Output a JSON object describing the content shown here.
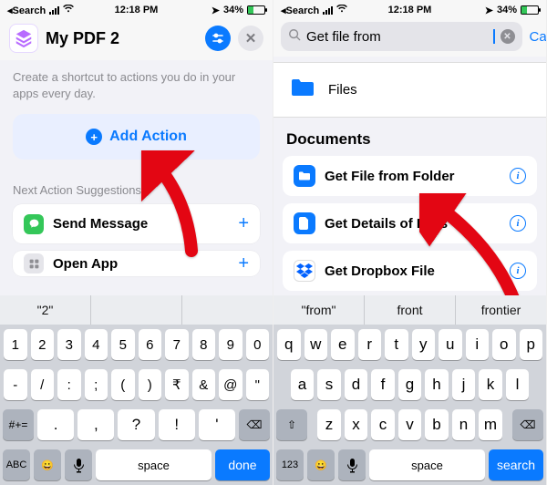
{
  "status": {
    "back": "Search",
    "time": "12:18 PM",
    "battery_pct": "34%"
  },
  "left": {
    "title": "My PDF 2",
    "desc": "Create a shortcut to actions you do in your apps every day.",
    "add_action": "Add Action",
    "suggestions_label": "Next Action Suggestions",
    "suggestions": [
      {
        "label": "Send Message"
      },
      {
        "label": "Open App"
      }
    ],
    "kbd_suggestions": [
      "\"2\"",
      "",
      ""
    ],
    "num_row": [
      "1",
      "2",
      "3",
      "4",
      "5",
      "6",
      "7",
      "8",
      "9",
      "0"
    ],
    "sym_row": [
      "-",
      "/",
      ":",
      ";",
      "(",
      ")",
      "₹",
      "&",
      "@",
      "\""
    ],
    "fn_row_left": "#+=",
    "fn_row_syms": [
      ".",
      ",",
      "?",
      "!",
      "'"
    ],
    "bottom": {
      "abc": "ABC",
      "space": "space",
      "done": "done"
    }
  },
  "right": {
    "search_value": "Get file from",
    "cancel": "Cancel",
    "files_label": "Files",
    "documents_label": "Documents",
    "doc_items": [
      {
        "label": "Get File from Folder"
      },
      {
        "label": "Get Details of Files"
      },
      {
        "label": "Get Dropbox File"
      }
    ],
    "kbd_suggestions": [
      "\"from\"",
      "front",
      "frontier"
    ],
    "row1": [
      "q",
      "w",
      "e",
      "r",
      "t",
      "y",
      "u",
      "i",
      "o",
      "p"
    ],
    "row2": [
      "a",
      "s",
      "d",
      "f",
      "g",
      "h",
      "j",
      "k",
      "l"
    ],
    "row3": [
      "z",
      "x",
      "c",
      "v",
      "b",
      "n",
      "m"
    ],
    "bottom": {
      "num": "123",
      "space": "space",
      "search": "search"
    }
  }
}
